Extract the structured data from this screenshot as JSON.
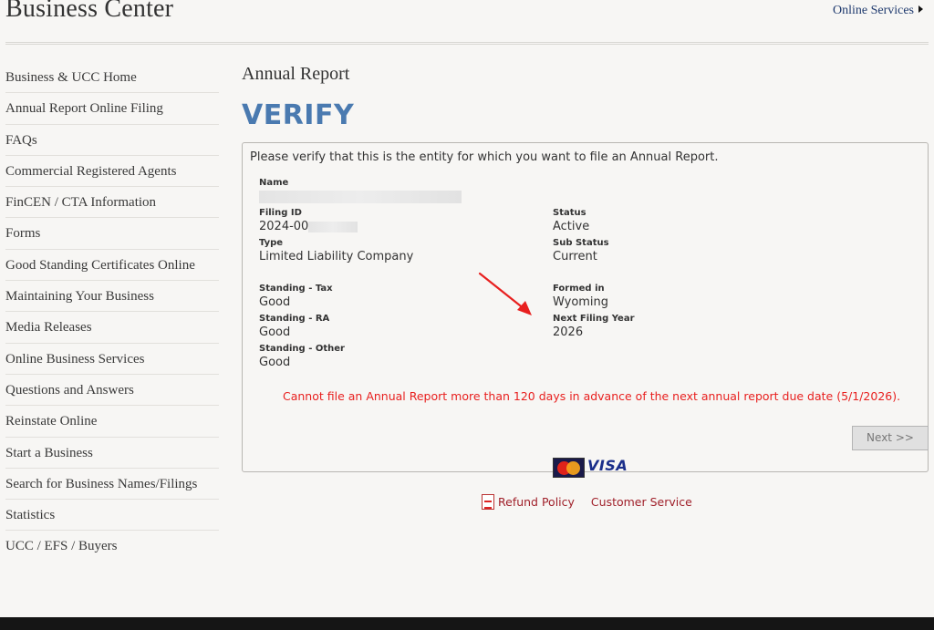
{
  "header": {
    "site_title": "Business Center",
    "online_services": "Online Services"
  },
  "sidebar": {
    "items": [
      {
        "label": "Business & UCC Home"
      },
      {
        "label": "Annual Report Online Filing"
      },
      {
        "label": "FAQs"
      },
      {
        "label": "Commercial Registered Agents"
      },
      {
        "label": "FinCEN / CTA Information"
      },
      {
        "label": "Forms"
      },
      {
        "label": "Good Standing Certificates Online"
      },
      {
        "label": "Maintaining Your Business"
      },
      {
        "label": "Media Releases"
      },
      {
        "label": "Online Business Services"
      },
      {
        "label": "Questions and Answers"
      },
      {
        "label": "Reinstate Online"
      },
      {
        "label": "Start a Business"
      },
      {
        "label": "Search for Business Names/Filings"
      },
      {
        "label": "Statistics"
      },
      {
        "label": "UCC / EFS / Buyers"
      }
    ]
  },
  "main": {
    "heading": "Annual Report",
    "verify_title": "VERIFY",
    "intro": "Please verify that this is the entity for which you want to file an Annual Report.",
    "fields": {
      "name": {
        "label": "Name",
        "value": ""
      },
      "filing_id": {
        "label": "Filing ID",
        "value": "2024-00"
      },
      "status": {
        "label": "Status",
        "value": "Active"
      },
      "type": {
        "label": "Type",
        "value": "Limited Liability Company"
      },
      "sub_status": {
        "label": "Sub Status",
        "value": "Current"
      },
      "standing_tax": {
        "label": "Standing - Tax",
        "value": "Good"
      },
      "formed_in": {
        "label": "Formed in",
        "value": "Wyoming"
      },
      "standing_ra": {
        "label": "Standing - RA",
        "value": "Good"
      },
      "next_filing_year": {
        "label": "Next Filing Year",
        "value": "2026"
      },
      "standing_other": {
        "label": "Standing - Other",
        "value": "Good"
      }
    },
    "warning": "Cannot file an Annual Report more than 120 days in advance of the next annual report due date (5/1/2026).",
    "next_button": "Next >>",
    "payment": {
      "mastercard_icon": "mastercard-logo",
      "visa_text": "VISA"
    },
    "links": {
      "refund_policy": "Refund Policy",
      "customer_service": "Customer Service"
    }
  },
  "colors": {
    "background": "#f7f6f4",
    "verify_blue": "#4a7ab0",
    "warning_red": "#e8201f",
    "link_red": "#a0202a",
    "arrow_red": "#e8201f"
  }
}
